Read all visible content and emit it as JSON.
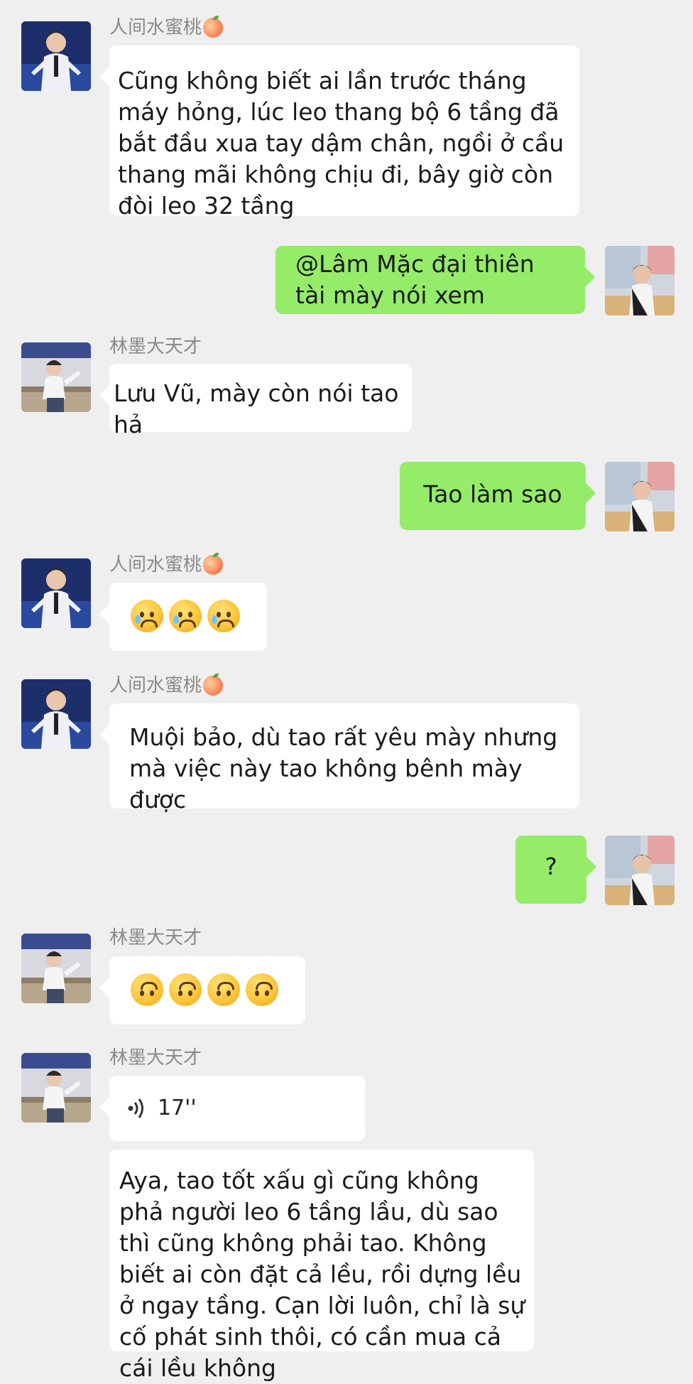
{
  "users": {
    "peach": {
      "name": "人间水蜜桃",
      "emoji_icon": "peach-emoji-icon"
    },
    "genius": {
      "name": "林墨大天才"
    }
  },
  "messages": [
    {
      "side": "left",
      "user": "peach",
      "text": "Cũng không biết ai lần trước tháng máy hỏng, lúc leo thang bộ 6 tầng đã bắt đầu xua tay dậm chân, ngồi ở cầu thang mãi không chịu đi, bây giờ còn đòi leo 32 tầng"
    },
    {
      "side": "right",
      "text": "@Lâm Mặc đại thiên tài mày nói xem"
    },
    {
      "side": "left",
      "user": "genius",
      "text": "Lưu Vũ, mày còn nói tao hả"
    },
    {
      "side": "right",
      "text": "Tao làm sao"
    },
    {
      "side": "left",
      "user": "peach",
      "emojis": [
        "sad-sweat-emoji-icon",
        "sad-sweat-emoji-icon",
        "sad-sweat-emoji-icon"
      ]
    },
    {
      "side": "left",
      "user": "peach",
      "text": "Muội bảo, dù tao rất yêu mày nhưng mà việc này tao không bênh mày được"
    },
    {
      "side": "right",
      "text": "?"
    },
    {
      "side": "left",
      "user": "genius",
      "emojis": [
        "upside-down-face-emoji-icon",
        "upside-down-face-emoji-icon",
        "upside-down-face-emoji-icon",
        "upside-down-face-emoji-icon"
      ]
    },
    {
      "side": "left",
      "user": "genius",
      "voice_duration": "17''",
      "text": "Aya, tao tốt xấu gì cũng không phả người leo 6 tầng lầu, dù sao thì cũng không phải tao. Không biết ai còn đặt cả lều, rồi dựng lều ở ngay tầng. Cạn lời luôn, chỉ là sự cố phát sinh thôi, có cần mua cả cái lều không"
    }
  ],
  "colors": {
    "background": "#efefef",
    "incoming_bubble": "#ffffff",
    "outgoing_bubble": "#95ec69",
    "name_text": "#8a8a8a"
  }
}
